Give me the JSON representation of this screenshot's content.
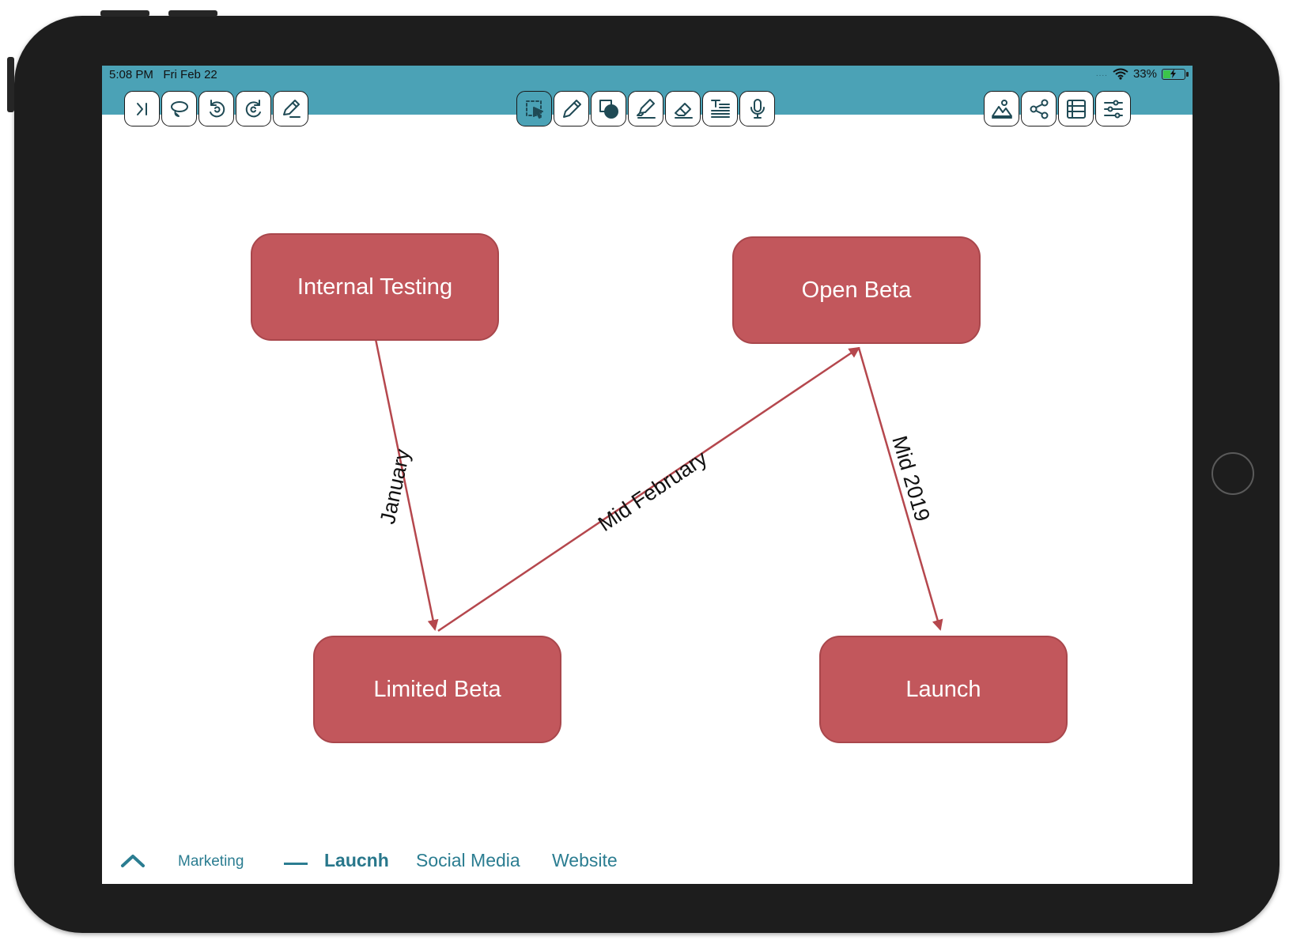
{
  "status_bar": {
    "time": "5:08 PM",
    "date": "Fri Feb 22",
    "signal_dots": "....",
    "wifi_icon": "wifi-icon",
    "battery_percent": "33%",
    "battery_level": 0.33,
    "charging_icon": "lightning-icon"
  },
  "toolbar": {
    "left": [
      {
        "icon": "collapse-panel-icon"
      },
      {
        "icon": "lasso-icon"
      },
      {
        "icon": "undo-icon"
      },
      {
        "icon": "redo-icon"
      },
      {
        "icon": "edit-pen-icon"
      }
    ],
    "center": [
      {
        "icon": "select-icon",
        "active": true
      },
      {
        "icon": "pencil-icon"
      },
      {
        "icon": "shapes-icon"
      },
      {
        "icon": "highlighter-icon"
      },
      {
        "icon": "eraser-icon"
      },
      {
        "icon": "text-icon"
      },
      {
        "icon": "microphone-icon"
      }
    ],
    "right": [
      {
        "icon": "image-icon"
      },
      {
        "icon": "share-icon"
      },
      {
        "icon": "list-icon"
      },
      {
        "icon": "settings-sliders-icon"
      }
    ]
  },
  "diagram": {
    "node_color": "#c2575c",
    "edge_color": "#b5474d",
    "nodes": {
      "internal_testing": "Internal Testing",
      "open_beta": "Open Beta",
      "limited_beta": "Limited Beta",
      "launch": "Launch"
    },
    "edges": {
      "january": "January",
      "mid_february": "Mid February",
      "mid_2019": "Mid 2019"
    }
  },
  "bottom_tabs": {
    "caret_icon": "chevron-up-icon",
    "marketing": "Marketing",
    "current_indicator": "—",
    "current": "Laucnh",
    "social_media": "Social Media",
    "website": "Website"
  },
  "colors": {
    "toolbar": "#4ba2b6",
    "accent_text": "#2b7d91"
  }
}
